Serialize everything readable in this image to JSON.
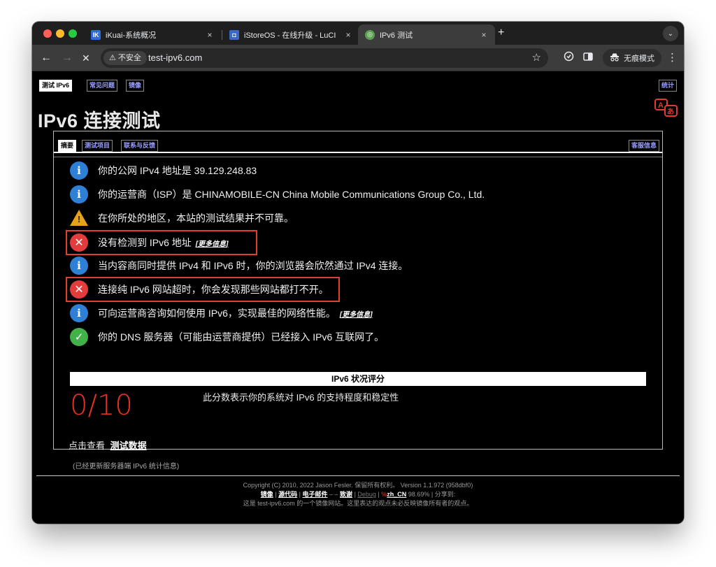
{
  "browser": {
    "tabs": [
      {
        "favicon": "IK",
        "favicon_color": "#2d6bdc",
        "title": "iKuai-系统概况",
        "close": "×"
      },
      {
        "favicon": "◘",
        "favicon_color": "#3a68c8",
        "title": "iStoreOS - 在线升级 - LuCI",
        "close": "×"
      },
      {
        "favicon": "◎",
        "favicon_color": "#59a14f",
        "title": "IPv6 测试",
        "close": "×"
      }
    ],
    "new_tab": "+",
    "tab_dropdown": "⌄",
    "back": "←",
    "forward": "→",
    "stop": "✕",
    "security_label": "不安全",
    "security_icon": "⚠",
    "url": "test-ipv6.com",
    "star": "☆",
    "incognito_label": "无痕模式",
    "menu": "⋮"
  },
  "page": {
    "top_tabs": [
      "测试 IPv6",
      "常见问题",
      "镜像"
    ],
    "stats_tab": "统计",
    "title": "IPv6 连接测试",
    "panel_tabs": [
      "摘要",
      "测试项目",
      "联系与反馈"
    ],
    "support_tab": "客服信息",
    "rows": [
      {
        "icon": "i",
        "type": "info",
        "text": "你的公网 IPv4 地址是 39.129.248.83",
        "more": ""
      },
      {
        "icon": "i",
        "type": "info",
        "text": "你的运营商（ISP）是 CHINAMOBILE-CN China Mobile Communications Group Co., Ltd.",
        "more": ""
      },
      {
        "icon": "!",
        "type": "warn",
        "text": "在你所处的地区，本站的测试结果并不可靠。",
        "more": ""
      },
      {
        "icon": "✕",
        "type": "err",
        "text": "没有检测到 IPv6 地址",
        "more": "[更多信息]"
      },
      {
        "icon": "i",
        "type": "info",
        "text": "当内容商同时提供 IPv4 和 IPv6 时，你的浏览器会欣然通过 IPv4 连接。",
        "more": ""
      },
      {
        "icon": "✕",
        "type": "err",
        "text": "连接纯 IPv6 网站超时，你会发现那些网站都打不开。",
        "more": ""
      },
      {
        "icon": "i",
        "type": "info",
        "text": "可向运营商咨询如何使用 IPv6，实现最佳的网络性能。",
        "more": "[更多信息]"
      },
      {
        "icon": "✓",
        "type": "ok",
        "text": "你的 DNS 服务器（可能由运营商提供）已经接入 IPv6 互联网了。",
        "more": ""
      }
    ],
    "score_header": "IPv6 状况评分",
    "score": "0/10",
    "score_desc": "此分数表示你的系统对 IPv6 的支持程度和稳定性",
    "data_prefix": "点击查看",
    "data_link": "测试数据",
    "updated": "(已经更新服务器端 IPv6 统计信息)",
    "footer": {
      "copyright": "Copyright (C) 2010, 2022 Jason Fesler. 保留所有权利。 Version 1.1.972 (958dbf0)",
      "mirror": "镜像",
      "source": "源代码",
      "email": "电子邮件",
      "sep_dash": "–",
      "thanks": "致谢",
      "debug": "Debug",
      "locale": "zh_CN",
      "percent": "98.69%",
      "share": "分享到:",
      "note": "这是 test-ipv6.com 的一个镜像网站。这里表达的观点未必反映镜像所有者的观点。"
    }
  },
  "colors": {
    "error_red": "#e23c3c",
    "info_blue": "#2e7fd6",
    "ok_green": "#43b14a",
    "warn_orange": "#e8a21a",
    "score_red": "#e83020",
    "highlight": "#e2402f"
  }
}
